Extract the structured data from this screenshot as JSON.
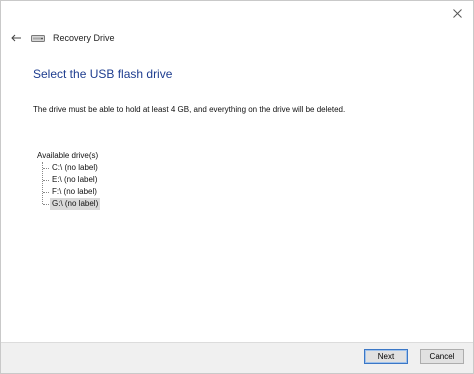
{
  "window": {
    "title": "Recovery Drive"
  },
  "icons": {
    "close": "close-icon",
    "back": "back-arrow-icon",
    "app": "drive-icon"
  },
  "page": {
    "heading": "Select the USB flash drive",
    "description": "The drive must be able to hold at least 4 GB, and everything on the drive will be deleted."
  },
  "drives": {
    "root_label": "Available drive(s)",
    "items": [
      {
        "label": "C:\\ (no label)",
        "selected": false
      },
      {
        "label": "E:\\ (no label)",
        "selected": false
      },
      {
        "label": "F:\\ (no label)",
        "selected": false
      },
      {
        "label": "G:\\ (no label)",
        "selected": true
      }
    ]
  },
  "footer": {
    "next_label": "Next",
    "cancel_label": "Cancel"
  },
  "colors": {
    "heading": "#1e3d8f",
    "footer_bg": "#f0f0f0",
    "selected_bg": "#d9d9d9",
    "default_button_border": "#3b77c6"
  }
}
